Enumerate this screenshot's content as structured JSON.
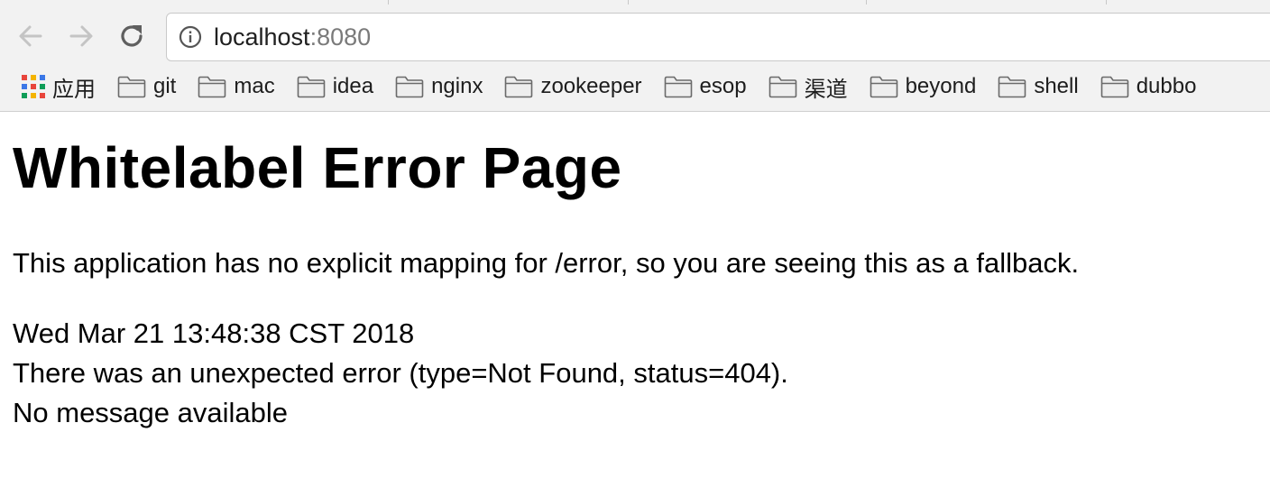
{
  "browser": {
    "url_host": "localhost",
    "url_port": ":8080"
  },
  "bookmarks": [
    {
      "label": "应用",
      "icon": "apps-grid-icon"
    },
    {
      "label": "git",
      "icon": "folder-icon"
    },
    {
      "label": "mac",
      "icon": "folder-icon"
    },
    {
      "label": "idea",
      "icon": "folder-icon"
    },
    {
      "label": "nginx",
      "icon": "folder-icon"
    },
    {
      "label": "zookeeper",
      "icon": "folder-icon"
    },
    {
      "label": "esop",
      "icon": "folder-icon"
    },
    {
      "label": "渠道",
      "icon": "folder-icon"
    },
    {
      "label": "beyond",
      "icon": "folder-icon"
    },
    {
      "label": "shell",
      "icon": "folder-icon"
    },
    {
      "label": "dubbo",
      "icon": "folder-icon"
    }
  ],
  "page": {
    "title": "Whitelabel Error Page",
    "message": "This application has no explicit mapping for /error, so you are seeing this as a fallback.",
    "timestamp": "Wed Mar 21 13:48:38 CST 2018",
    "error_line": "There was an unexpected error (type=Not Found, status=404).",
    "detail_line": "No message available"
  }
}
